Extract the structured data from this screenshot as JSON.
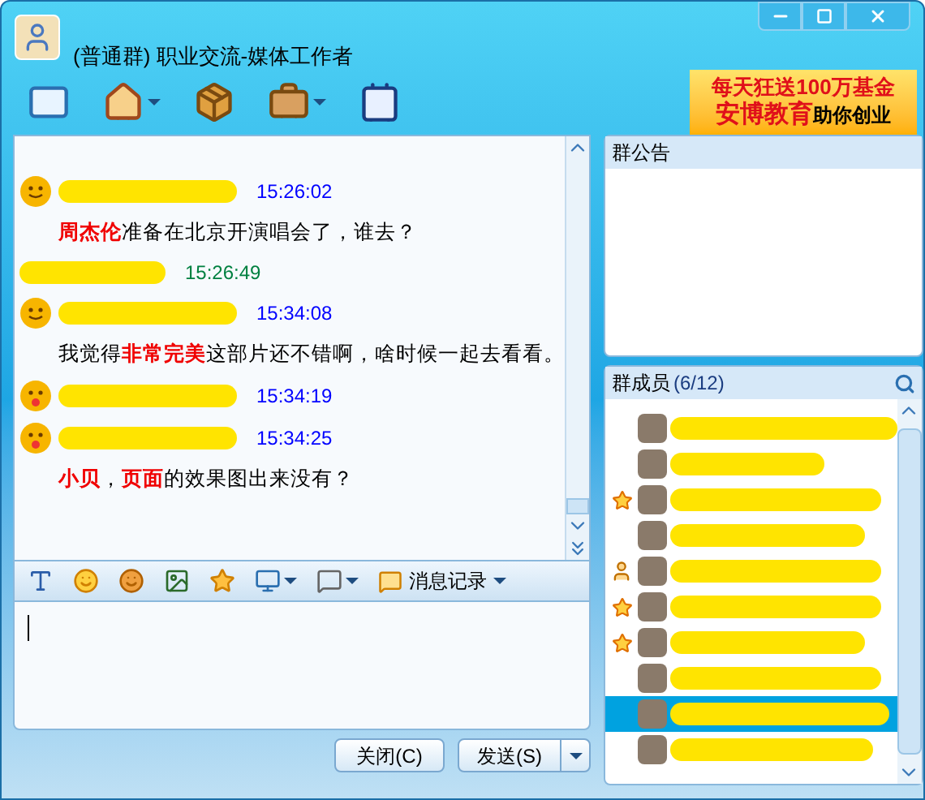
{
  "window": {
    "title": "(普通群) 职业交流-媒体工作者"
  },
  "ad": {
    "line1": "每天狂送100万基金",
    "line2_brand": "安博教育",
    "line2_rest": "助你创业"
  },
  "messages": [
    {
      "kind": "smile",
      "own": false,
      "time": "15:26:02",
      "text": "**周杰伦**准备在北京开演唱会了，谁去？"
    },
    {
      "kind": "none",
      "own": true,
      "time": "15:26:49"
    },
    {
      "kind": "smile",
      "own": false,
      "time": "15:34:08",
      "text": "我觉得**非常完美**这部片还不错啊，啥时候一起去看看。"
    },
    {
      "kind": "tongue",
      "own": false,
      "time": "15:34:19"
    },
    {
      "kind": "tongue",
      "own": false,
      "time": "15:34:25",
      "text": "**小贝**，**页面**的效果图出来没有？"
    }
  ],
  "history_button": "消息记录",
  "announcement": {
    "title": "群公告"
  },
  "members": {
    "title": "群成员",
    "count": "(6/12)",
    "items": [
      {
        "kind": "plain",
        "selected": false
      },
      {
        "kind": "plain",
        "selected": false
      },
      {
        "kind": "star",
        "selected": false
      },
      {
        "kind": "plain",
        "selected": false
      },
      {
        "kind": "admin",
        "selected": false
      },
      {
        "kind": "star",
        "selected": false
      },
      {
        "kind": "star",
        "selected": false
      },
      {
        "kind": "plain",
        "selected": false
      },
      {
        "kind": "plain",
        "selected": true
      },
      {
        "kind": "plain",
        "selected": false
      }
    ]
  },
  "buttons": {
    "close": "关闭(C)",
    "send": "发送(S)"
  }
}
